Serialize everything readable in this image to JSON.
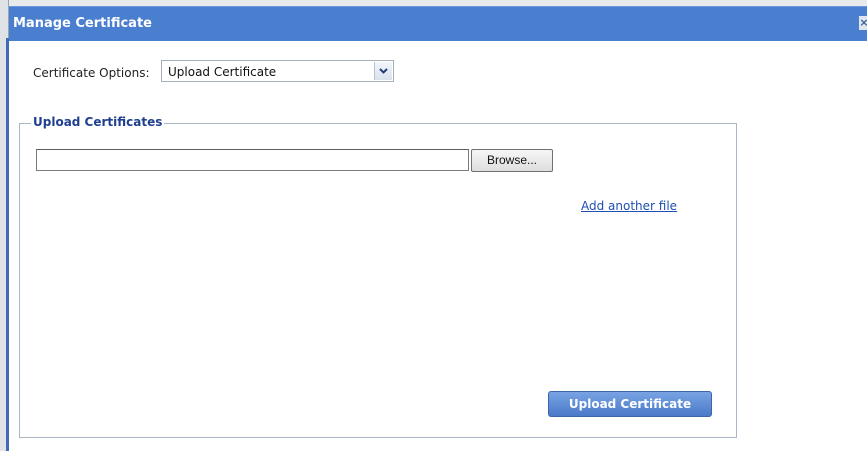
{
  "window": {
    "title": "Manage Certificate",
    "close_icon": "close-icon"
  },
  "options": {
    "label": "Certificate Options:",
    "selected": "Upload Certificate",
    "dropdown_icon": "chevron-down-icon"
  },
  "upload_section": {
    "legend": "Upload Certificates",
    "file_value": "",
    "browse_label": "Browse...",
    "add_link_label": "Add another file",
    "upload_button_label": "Upload Certificate"
  },
  "colors": {
    "title_bar": "#4a7fd0",
    "legend_text": "#1f3f8f",
    "link": "#1f4fb3",
    "primary_button": "#4a79c8"
  }
}
